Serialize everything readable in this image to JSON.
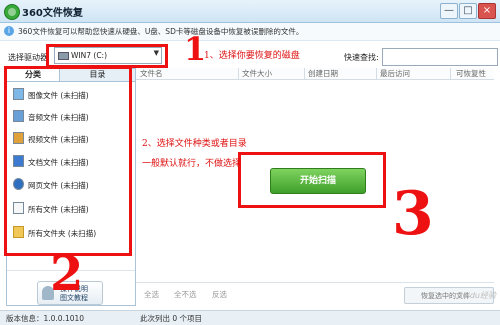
{
  "window": {
    "title": "360文件恢复",
    "minimize_glyph": "—",
    "maximize_glyph": "□",
    "close_glyph": "×"
  },
  "info": {
    "icon": "info-icon",
    "text": "360文件恢复可以帮助您快速从硬盘、U盘、SD卡等磁盘设备中恢复被误删除的文件。"
  },
  "drive": {
    "label": "选择驱动器",
    "value": "WIN7 (C:)",
    "arrow": "▼"
  },
  "quick_search": {
    "label": "快速查找:",
    "value": ""
  },
  "tabs": [
    {
      "label": "分类"
    },
    {
      "label": "目录"
    }
  ],
  "categories": [
    {
      "label": "图像文件 (未扫描)",
      "icon": "image-file-icon"
    },
    {
      "label": "音频文件 (未扫描)",
      "icon": "audio-file-icon"
    },
    {
      "label": "视频文件 (未扫描)",
      "icon": "video-file-icon"
    },
    {
      "label": "文档文件 (未扫描)",
      "icon": "document-file-icon"
    },
    {
      "label": "网页文件 (未扫描)",
      "icon": "web-file-icon"
    },
    {
      "label": "所有文件 (未扫描)",
      "icon": "all-files-icon"
    },
    {
      "label": "所有文件夹 (未扫描)",
      "icon": "folder-icon"
    }
  ],
  "tutorial": {
    "line1": "操作说明",
    "line2": "图文教程"
  },
  "columns": [
    "文件名",
    "文件大小",
    "创建日期",
    "最后访问",
    "可恢复性"
  ],
  "scan_button": "开始扫描",
  "bottom": {
    "select_all": "全选",
    "select_none": "全不选",
    "invert": "反选",
    "recover_selected": "恢复选中的文件"
  },
  "status": {
    "version": "版本信息：1.0.0.1010",
    "listed": "此次列出 0 个项目"
  },
  "annotations": {
    "note1": "1、选择你要恢复的磁盘",
    "note2": "2、选择文件种类或者目录",
    "note3": "一般默认就行，不做选择",
    "num1": "1",
    "num2": "2",
    "num3": "3",
    "color": "#e11111"
  },
  "watermark": "Baidu经验"
}
